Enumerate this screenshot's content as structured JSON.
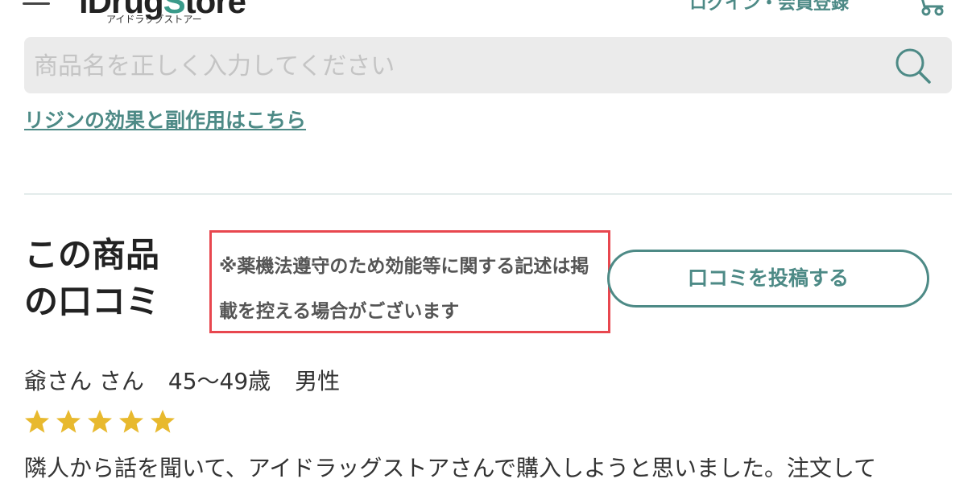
{
  "header": {
    "logo_text_prefix": "iDrug",
    "logo_text_accent": "S",
    "logo_text_suffix": "tore",
    "logo_subtitle": "アイドラッグストアー",
    "login_register_label": "ログイン・会員登録"
  },
  "search": {
    "placeholder": "商品名を正しく入力してください"
  },
  "effects_link": "リジンの効果と副作用はこちら",
  "reviews": {
    "title": "この商品の口コミ",
    "notice": "※薬機法遵守のため効能等に関する記述は掲載を控える場合がございます",
    "post_button_label": "口コミを投稿する"
  },
  "review": {
    "name": "爺さん さん",
    "age": "45〜49歳",
    "gender": "男性",
    "rating": 5,
    "text_preview": "隣人から話を聞いて、アイドラッグストアさんで購入しようと思いました。注文して"
  },
  "colors": {
    "accent": "#4d8a86",
    "notice_border": "#e8474f",
    "star": "#e8b92e",
    "search_bg": "#ebebeb"
  },
  "icons": [
    "hamburger-menu-icon",
    "cart-icon",
    "search-icon",
    "star-icon"
  ]
}
